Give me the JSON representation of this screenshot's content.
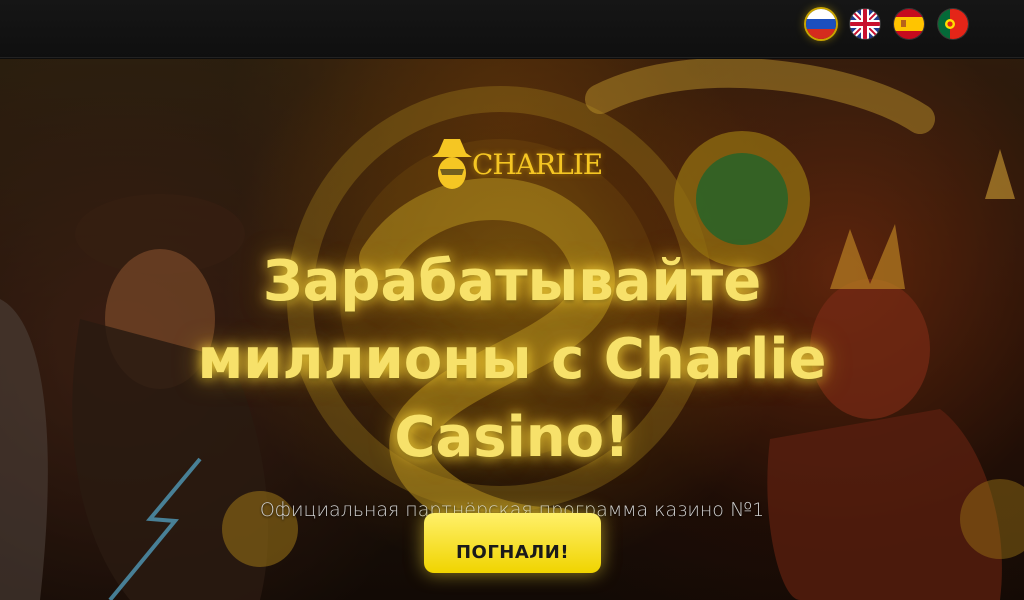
{
  "header": {
    "languages": [
      {
        "code": "ru",
        "icon": "flag-russia-icon",
        "active": true
      },
      {
        "code": "en",
        "icon": "flag-uk-icon",
        "active": false
      },
      {
        "code": "es",
        "icon": "flag-spain-icon",
        "active": false
      },
      {
        "code": "pt",
        "icon": "flag-portugal-icon",
        "active": false
      }
    ]
  },
  "hero": {
    "logo_text": "CHARLIE",
    "headline_line1": "Зарабатывайте",
    "headline_line2": "миллионы с Charlie",
    "headline_line3": "Casino!",
    "subtitle": "Официальная партнёрская программа казино №1",
    "cta_label": "ПОГНАЛИ!"
  },
  "colors": {
    "accent": "#f7e16a",
    "button": "#f0d400",
    "header_bg": "#121212"
  }
}
